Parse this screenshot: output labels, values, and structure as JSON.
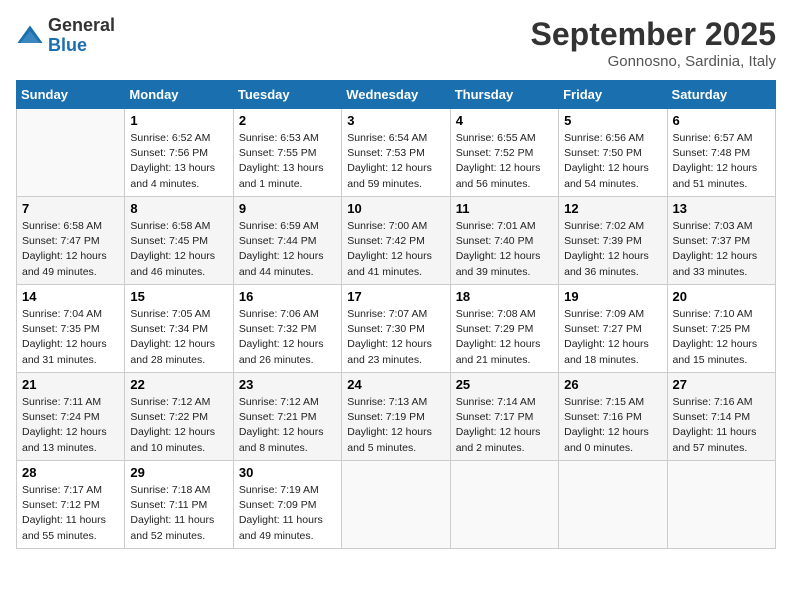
{
  "logo": {
    "general": "General",
    "blue": "Blue"
  },
  "header": {
    "month_title": "September 2025",
    "location": "Gonnosno, Sardinia, Italy"
  },
  "weekdays": [
    "Sunday",
    "Monday",
    "Tuesday",
    "Wednesday",
    "Thursday",
    "Friday",
    "Saturday"
  ],
  "weeks": [
    [
      {
        "day": "",
        "sunrise": "",
        "sunset": "",
        "daylight": ""
      },
      {
        "day": "1",
        "sunrise": "Sunrise: 6:52 AM",
        "sunset": "Sunset: 7:56 PM",
        "daylight": "Daylight: 13 hours and 4 minutes."
      },
      {
        "day": "2",
        "sunrise": "Sunrise: 6:53 AM",
        "sunset": "Sunset: 7:55 PM",
        "daylight": "Daylight: 13 hours and 1 minute."
      },
      {
        "day": "3",
        "sunrise": "Sunrise: 6:54 AM",
        "sunset": "Sunset: 7:53 PM",
        "daylight": "Daylight: 12 hours and 59 minutes."
      },
      {
        "day": "4",
        "sunrise": "Sunrise: 6:55 AM",
        "sunset": "Sunset: 7:52 PM",
        "daylight": "Daylight: 12 hours and 56 minutes."
      },
      {
        "day": "5",
        "sunrise": "Sunrise: 6:56 AM",
        "sunset": "Sunset: 7:50 PM",
        "daylight": "Daylight: 12 hours and 54 minutes."
      },
      {
        "day": "6",
        "sunrise": "Sunrise: 6:57 AM",
        "sunset": "Sunset: 7:48 PM",
        "daylight": "Daylight: 12 hours and 51 minutes."
      }
    ],
    [
      {
        "day": "7",
        "sunrise": "Sunrise: 6:58 AM",
        "sunset": "Sunset: 7:47 PM",
        "daylight": "Daylight: 12 hours and 49 minutes."
      },
      {
        "day": "8",
        "sunrise": "Sunrise: 6:58 AM",
        "sunset": "Sunset: 7:45 PM",
        "daylight": "Daylight: 12 hours and 46 minutes."
      },
      {
        "day": "9",
        "sunrise": "Sunrise: 6:59 AM",
        "sunset": "Sunset: 7:44 PM",
        "daylight": "Daylight: 12 hours and 44 minutes."
      },
      {
        "day": "10",
        "sunrise": "Sunrise: 7:00 AM",
        "sunset": "Sunset: 7:42 PM",
        "daylight": "Daylight: 12 hours and 41 minutes."
      },
      {
        "day": "11",
        "sunrise": "Sunrise: 7:01 AM",
        "sunset": "Sunset: 7:40 PM",
        "daylight": "Daylight: 12 hours and 39 minutes."
      },
      {
        "day": "12",
        "sunrise": "Sunrise: 7:02 AM",
        "sunset": "Sunset: 7:39 PM",
        "daylight": "Daylight: 12 hours and 36 minutes."
      },
      {
        "day": "13",
        "sunrise": "Sunrise: 7:03 AM",
        "sunset": "Sunset: 7:37 PM",
        "daylight": "Daylight: 12 hours and 33 minutes."
      }
    ],
    [
      {
        "day": "14",
        "sunrise": "Sunrise: 7:04 AM",
        "sunset": "Sunset: 7:35 PM",
        "daylight": "Daylight: 12 hours and 31 minutes."
      },
      {
        "day": "15",
        "sunrise": "Sunrise: 7:05 AM",
        "sunset": "Sunset: 7:34 PM",
        "daylight": "Daylight: 12 hours and 28 minutes."
      },
      {
        "day": "16",
        "sunrise": "Sunrise: 7:06 AM",
        "sunset": "Sunset: 7:32 PM",
        "daylight": "Daylight: 12 hours and 26 minutes."
      },
      {
        "day": "17",
        "sunrise": "Sunrise: 7:07 AM",
        "sunset": "Sunset: 7:30 PM",
        "daylight": "Daylight: 12 hours and 23 minutes."
      },
      {
        "day": "18",
        "sunrise": "Sunrise: 7:08 AM",
        "sunset": "Sunset: 7:29 PM",
        "daylight": "Daylight: 12 hours and 21 minutes."
      },
      {
        "day": "19",
        "sunrise": "Sunrise: 7:09 AM",
        "sunset": "Sunset: 7:27 PM",
        "daylight": "Daylight: 12 hours and 18 minutes."
      },
      {
        "day": "20",
        "sunrise": "Sunrise: 7:10 AM",
        "sunset": "Sunset: 7:25 PM",
        "daylight": "Daylight: 12 hours and 15 minutes."
      }
    ],
    [
      {
        "day": "21",
        "sunrise": "Sunrise: 7:11 AM",
        "sunset": "Sunset: 7:24 PM",
        "daylight": "Daylight: 12 hours and 13 minutes."
      },
      {
        "day": "22",
        "sunrise": "Sunrise: 7:12 AM",
        "sunset": "Sunset: 7:22 PM",
        "daylight": "Daylight: 12 hours and 10 minutes."
      },
      {
        "day": "23",
        "sunrise": "Sunrise: 7:12 AM",
        "sunset": "Sunset: 7:21 PM",
        "daylight": "Daylight: 12 hours and 8 minutes."
      },
      {
        "day": "24",
        "sunrise": "Sunrise: 7:13 AM",
        "sunset": "Sunset: 7:19 PM",
        "daylight": "Daylight: 12 hours and 5 minutes."
      },
      {
        "day": "25",
        "sunrise": "Sunrise: 7:14 AM",
        "sunset": "Sunset: 7:17 PM",
        "daylight": "Daylight: 12 hours and 2 minutes."
      },
      {
        "day": "26",
        "sunrise": "Sunrise: 7:15 AM",
        "sunset": "Sunset: 7:16 PM",
        "daylight": "Daylight: 12 hours and 0 minutes."
      },
      {
        "day": "27",
        "sunrise": "Sunrise: 7:16 AM",
        "sunset": "Sunset: 7:14 PM",
        "daylight": "Daylight: 11 hours and 57 minutes."
      }
    ],
    [
      {
        "day": "28",
        "sunrise": "Sunrise: 7:17 AM",
        "sunset": "Sunset: 7:12 PM",
        "daylight": "Daylight: 11 hours and 55 minutes."
      },
      {
        "day": "29",
        "sunrise": "Sunrise: 7:18 AM",
        "sunset": "Sunset: 7:11 PM",
        "daylight": "Daylight: 11 hours and 52 minutes."
      },
      {
        "day": "30",
        "sunrise": "Sunrise: 7:19 AM",
        "sunset": "Sunset: 7:09 PM",
        "daylight": "Daylight: 11 hours and 49 minutes."
      },
      {
        "day": "",
        "sunrise": "",
        "sunset": "",
        "daylight": ""
      },
      {
        "day": "",
        "sunrise": "",
        "sunset": "",
        "daylight": ""
      },
      {
        "day": "",
        "sunrise": "",
        "sunset": "",
        "daylight": ""
      },
      {
        "day": "",
        "sunrise": "",
        "sunset": "",
        "daylight": ""
      }
    ]
  ]
}
